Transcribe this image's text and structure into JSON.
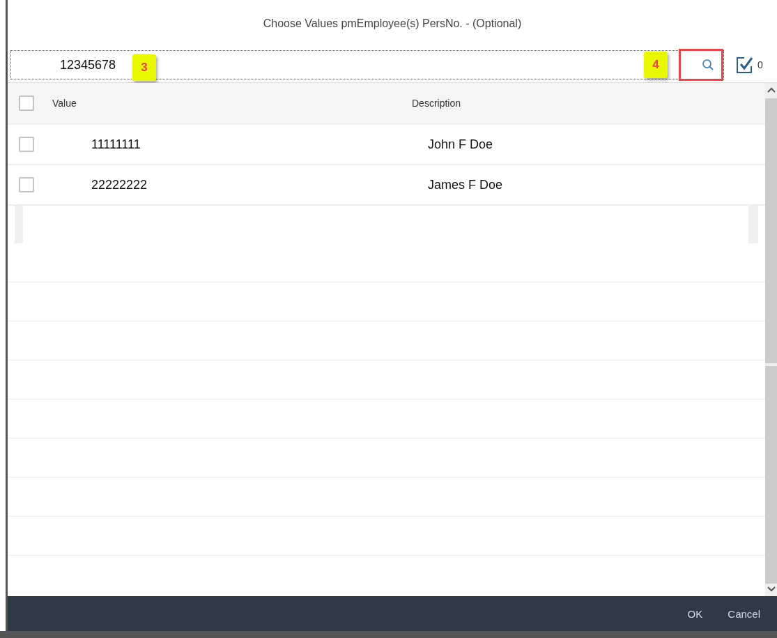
{
  "dialog": {
    "title": "Choose Values pmEmployee(s) PersNo. - (Optional)"
  },
  "search": {
    "value": "12345678",
    "value_callout": "3",
    "button_callout": "4",
    "button_highlighted": true
  },
  "selected_count": "0",
  "table": {
    "columns": [
      "Value",
      "Description"
    ],
    "header_checked": false,
    "rows": [
      {
        "value": "11111111",
        "description": "John F Doe",
        "checked": false
      },
      {
        "value": "22222222",
        "description": "James F Doe",
        "checked": false
      }
    ]
  },
  "footer": {
    "buttons": [
      "OK",
      "Cancel"
    ]
  }
}
